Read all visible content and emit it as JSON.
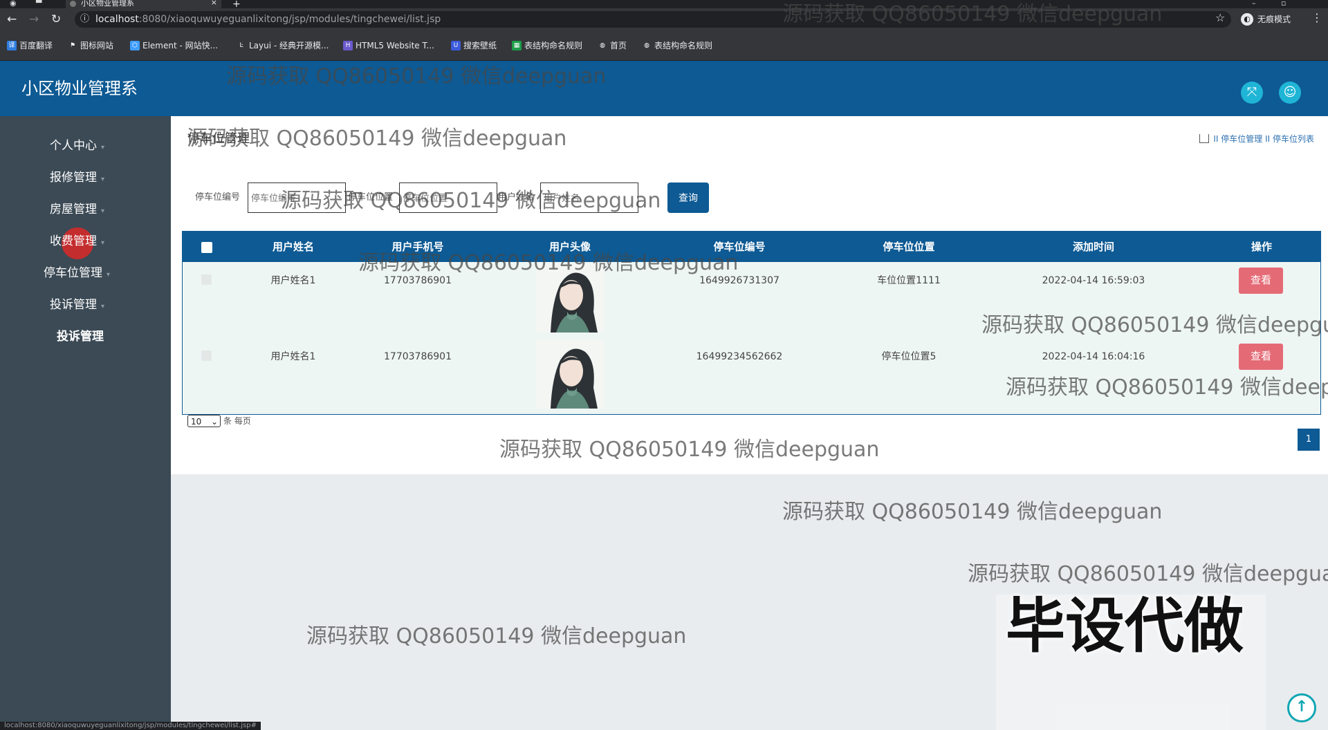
{
  "browser": {
    "tab_title": "小区物业管理系",
    "tab_close": "×",
    "new_tab": "+",
    "url_host": "localhost",
    "url_rest": ":8080/xiaoquwuyeguanlixitong/jsp/modules/tingchewei/list.jsp",
    "incognito_label": "无痕模式",
    "bookmarks": [
      "百度翻译",
      "图标网站",
      "Element - 网站快...",
      "Layui - 经典开源模...",
      "HTML5 Website T...",
      "搜索壁纸",
      "表结构命名规则",
      "首页",
      "表结构命名规则"
    ],
    "status_url": "localhost:8080/xiaoquwuyeguanlixitong/jsp/modules/tingchewei/list.jsp#"
  },
  "header": {
    "app_title": "小区物业管理系"
  },
  "sidebar": {
    "items": [
      {
        "label": "个人中心"
      },
      {
        "label": "报修管理"
      },
      {
        "label": "房屋管理"
      },
      {
        "label": "收费管理"
      },
      {
        "label": "停车位管理"
      },
      {
        "label": "投诉管理"
      },
      {
        "label": "投诉管理"
      }
    ]
  },
  "page": {
    "heading": "停车位管理",
    "breadcrumb": [
      "停车位管理",
      "停车位列表"
    ],
    "breadcrumb_sep": "II"
  },
  "search": {
    "fields": [
      {
        "label": "停车位编号",
        "placeholder": "停车位编号"
      },
      {
        "label": "停车位位置",
        "placeholder": "停车位位置"
      },
      {
        "label": "用户姓名",
        "placeholder": "用户姓名"
      }
    ],
    "button_label": "查询"
  },
  "table": {
    "columns": [
      "用户姓名",
      "用户手机号",
      "用户头像",
      "停车位编号",
      "停车位位置",
      "添加时间",
      "操作"
    ],
    "rows": [
      {
        "name": "用户姓名1",
        "phone": "17703786901",
        "code": "1649926731307",
        "location": "车位位置1111",
        "time": "2022-04-14 16:59:03",
        "action": "查看"
      },
      {
        "name": "用户姓名1",
        "phone": "17703786901",
        "code": "16499234562662",
        "location": "停车位位置5",
        "time": "2022-04-14 16:04:16",
        "action": "查看"
      }
    ]
  },
  "pager": {
    "page_size": "10",
    "page_size_suffix": "条 每页",
    "current_page": "1"
  },
  "overlays": {
    "watermark": "源码获取 QQ86050149 微信deepguan",
    "promo": "毕设代做"
  },
  "colors": {
    "header_bg": "#0d5a94",
    "sidebar_bg": "#3b4a55",
    "view_button": "#e46b76",
    "accent_cyan": "#1fb5d6"
  }
}
